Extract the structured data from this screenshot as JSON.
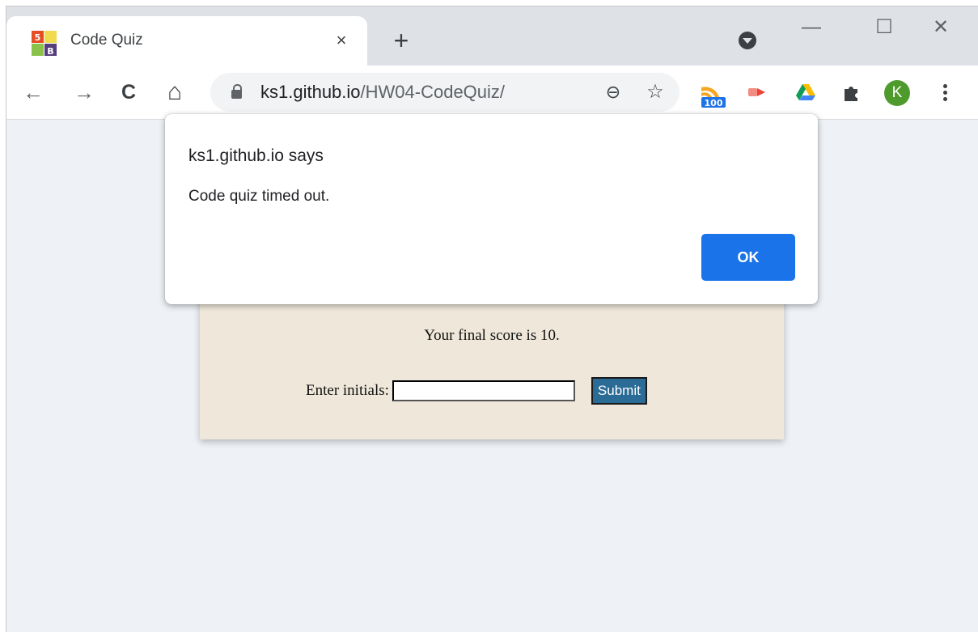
{
  "browser": {
    "tab": {
      "title": "Code Quiz",
      "close_glyph": "×",
      "favicon_icon": "html5-js-favicon-icon"
    },
    "new_tab_glyph": "+",
    "window_controls": {
      "minimize": "—",
      "maximize": "☐",
      "close": "✕"
    },
    "toolbar": {
      "back_glyph": "←",
      "forward_glyph": "→",
      "reload_glyph": "C",
      "home_glyph": "⌂",
      "url_host": "ks1.github.io",
      "url_path": "/HW04-CodeQuiz/",
      "zoom_glyph": "⊖",
      "bookmark_glyph": "☆"
    },
    "extensions": {
      "rss_badge": "100",
      "profile_initial": "K"
    }
  },
  "dialog": {
    "title": "ks1.github.io says",
    "message": "Code quiz timed out.",
    "ok_label": "OK"
  },
  "quiz": {
    "final_score_text": "Your final score is 10.",
    "initials_label": "Enter initials:",
    "initials_value": "",
    "submit_label": "Submit"
  },
  "colors": {
    "accent": "#1a73e8",
    "page_bg": "#eef2f6",
    "card_bg": "#efe8da",
    "submit_bg": "#2a6c95",
    "avatar_bg": "#4e9a2d"
  }
}
